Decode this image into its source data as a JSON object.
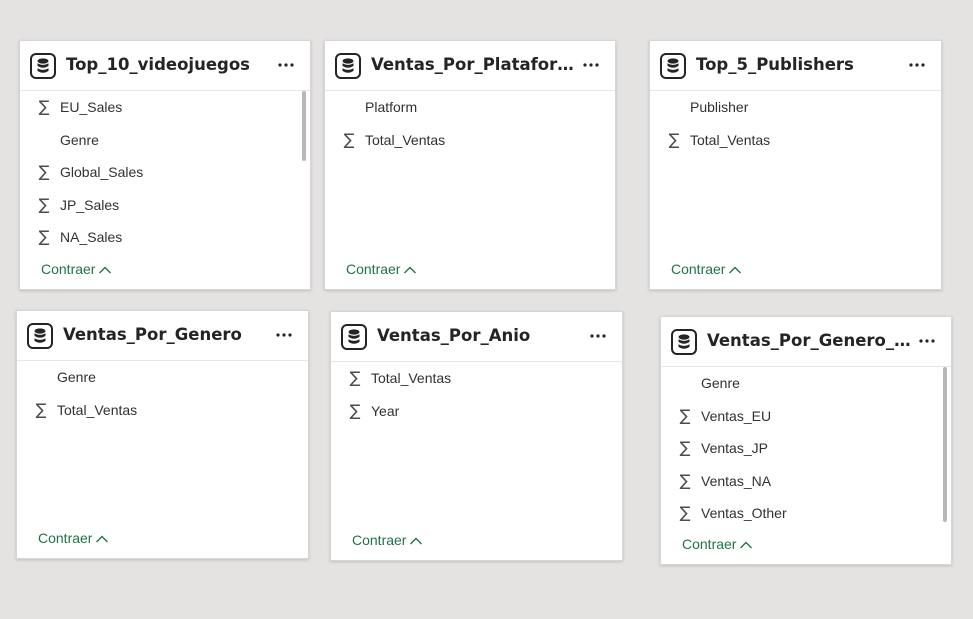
{
  "accent_color": "#217346",
  "icons": {
    "table": "database-icon",
    "more": "more-options-icon",
    "measure": "sigma-icon",
    "collapse": "chevron-up-icon"
  },
  "cards": [
    {
      "title": "Top_10_videojuegos",
      "collapse_label": "Contraer",
      "fields": [
        {
          "name": "EU_Sales",
          "sigma": "∑"
        },
        {
          "name": "Genre",
          "sigma": ""
        },
        {
          "name": "Global_Sales",
          "sigma": "∑"
        },
        {
          "name": "JP_Sales",
          "sigma": "∑"
        },
        {
          "name": "NA_Sales",
          "sigma": "∑"
        }
      ]
    },
    {
      "title": "Ventas_Por_Plataforma",
      "collapse_label": "Contraer",
      "fields": [
        {
          "name": "Platform",
          "sigma": ""
        },
        {
          "name": "Total_Ventas",
          "sigma": "∑"
        }
      ]
    },
    {
      "title": "Top_5_Publishers",
      "collapse_label": "Contraer",
      "fields": [
        {
          "name": "Publisher",
          "sigma": ""
        },
        {
          "name": "Total_Ventas",
          "sigma": "∑"
        }
      ]
    },
    {
      "title": "Ventas_Por_Genero",
      "collapse_label": "Contraer",
      "fields": [
        {
          "name": "Genre",
          "sigma": ""
        },
        {
          "name": "Total_Ventas",
          "sigma": "∑"
        }
      ]
    },
    {
      "title": "Ventas_Por_Anio",
      "collapse_label": "Contraer",
      "fields": [
        {
          "name": "Total_Ventas",
          "sigma": "∑"
        },
        {
          "name": "Year",
          "sigma": "∑"
        }
      ]
    },
    {
      "title": "Ventas_Por_Genero_Regio",
      "collapse_label": "Contraer",
      "fields": [
        {
          "name": "Genre",
          "sigma": ""
        },
        {
          "name": "Ventas_EU",
          "sigma": "∑"
        },
        {
          "name": "Ventas_JP",
          "sigma": "∑"
        },
        {
          "name": "Ventas_NA",
          "sigma": "∑"
        },
        {
          "name": "Ventas_Other",
          "sigma": "∑"
        }
      ]
    }
  ]
}
